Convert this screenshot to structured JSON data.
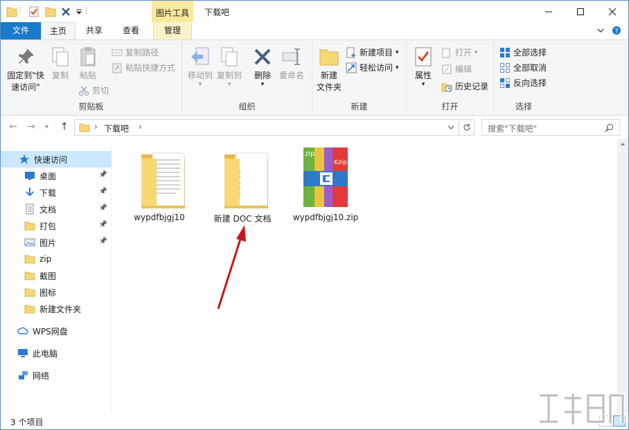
{
  "colors": {
    "accent": "#1979ca",
    "context_tab": "#f8e99c",
    "selection": "#cce8ff",
    "folder": "#f8d775",
    "arrow": "#c4161c"
  },
  "titlebar": {
    "context_tab": "图片工具",
    "title": "下载吧",
    "quick_access_icons": [
      "folder-icon",
      "properties-icon",
      "new-folder-icon",
      "undo-icon",
      "customize-dropdown-icon"
    ],
    "window_controls": [
      "minimize-icon",
      "maximize-icon",
      "close-icon"
    ]
  },
  "tabs": {
    "file": "文件",
    "home": "主页",
    "share": "共享",
    "view": "查看",
    "manage": "管理"
  },
  "ribbon": {
    "clipboard": {
      "label": "剪贴板",
      "pin_line1": "固定到\"快",
      "pin_line2": "速访问\"",
      "copy": "复制",
      "paste": "粘贴",
      "copy_path": "复制路径",
      "paste_shortcut": "粘贴快捷方式",
      "cut": "剪切"
    },
    "organize": {
      "label": "组织",
      "move_to": "移动到",
      "copy_to": "复制到",
      "delete": "删除",
      "rename": "重命名"
    },
    "new": {
      "label": "新建",
      "new_folder_line1": "新建",
      "new_folder_line2": "文件夹",
      "new_item": "新建项目",
      "easy_access": "轻松访问"
    },
    "open": {
      "label": "打开",
      "properties": "属性",
      "open": "打开",
      "edit": "编辑",
      "history": "历史记录"
    },
    "select": {
      "label": "选择",
      "select_all": "全部选择",
      "select_none": "全部取消",
      "invert": "反向选择"
    }
  },
  "address": {
    "path": "下载吧",
    "search_placeholder": "搜索\"下载吧\""
  },
  "nav": {
    "quick_access": "快速访问",
    "items": [
      {
        "label": "桌面",
        "icon": "desktop-icon",
        "pinned": true
      },
      {
        "label": "下载",
        "icon": "download-icon",
        "pinned": true
      },
      {
        "label": "文档",
        "icon": "document-icon",
        "pinned": true
      },
      {
        "label": "打包",
        "icon": "folder-icon",
        "pinned": true
      },
      {
        "label": "图片",
        "icon": "pictures-icon",
        "pinned": true
      },
      {
        "label": "zip",
        "icon": "folder-icon",
        "pinned": false
      },
      {
        "label": "截图",
        "icon": "folder-icon",
        "pinned": false
      },
      {
        "label": "图标",
        "icon": "folder-icon",
        "pinned": false
      },
      {
        "label": "新建文件夹",
        "icon": "folder-icon",
        "pinned": false
      }
    ],
    "wps": "WPS网盘",
    "this_pc": "此电脑",
    "network": "网络"
  },
  "files": [
    {
      "name": "wypdfbjgj10",
      "type": "folder"
    },
    {
      "name": "新建 DOC 文档",
      "type": "folder"
    },
    {
      "name": "wypdfbjgj10.zip",
      "type": "zip"
    }
  ],
  "zip_icon": {
    "top_left": "zip",
    "top_right": "Kzip"
  },
  "status": {
    "count": "3 个项目"
  }
}
